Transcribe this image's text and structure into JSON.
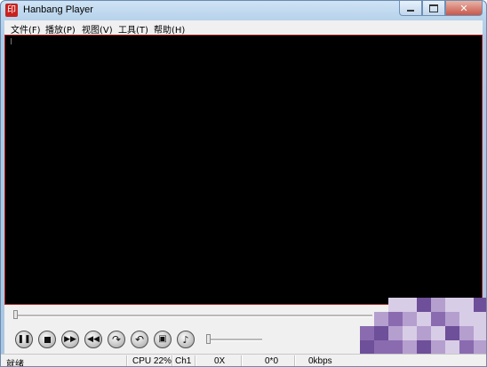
{
  "window": {
    "title": "Hanbang Player",
    "icon": "app-logo-icon"
  },
  "caption_buttons": {
    "minimize": "minimize-icon",
    "maximize": "maximize-icon",
    "close": "close-icon"
  },
  "menu": [
    {
      "label": "文件(F)"
    },
    {
      "label": "播放(P)"
    },
    {
      "label": "视图(V)"
    },
    {
      "label": "工具(T)"
    },
    {
      "label": "帮助(H)"
    }
  ],
  "seek": {
    "position_fraction": 0.0
  },
  "volume": {
    "level_fraction": 0.0
  },
  "controls": [
    {
      "name": "pause-button",
      "icon": "pause-icon"
    },
    {
      "name": "stop-button",
      "icon": "stop-icon"
    },
    {
      "name": "fast-forward-button",
      "icon": "fast-forward-icon"
    },
    {
      "name": "rewind-button",
      "icon": "rewind-icon"
    },
    {
      "name": "step-forward-button",
      "icon": "step-forward-icon"
    },
    {
      "name": "step-back-button",
      "icon": "step-back-icon"
    },
    {
      "name": "snapshot-button",
      "icon": "camera-icon"
    },
    {
      "name": "audio-button",
      "icon": "audio-icon"
    }
  ],
  "status": {
    "state": "就绪",
    "cpu": "CPU 22%",
    "channel": "Ch1",
    "hex": "0X",
    "frame": "0*0",
    "bitrate": "0kbps"
  },
  "colors": {
    "video_background": "#000000",
    "video_border": "#aa2222",
    "mosaic": [
      "#8a6bb0",
      "#b59fcf",
      "#d8cde6",
      "#6e4f99"
    ]
  }
}
